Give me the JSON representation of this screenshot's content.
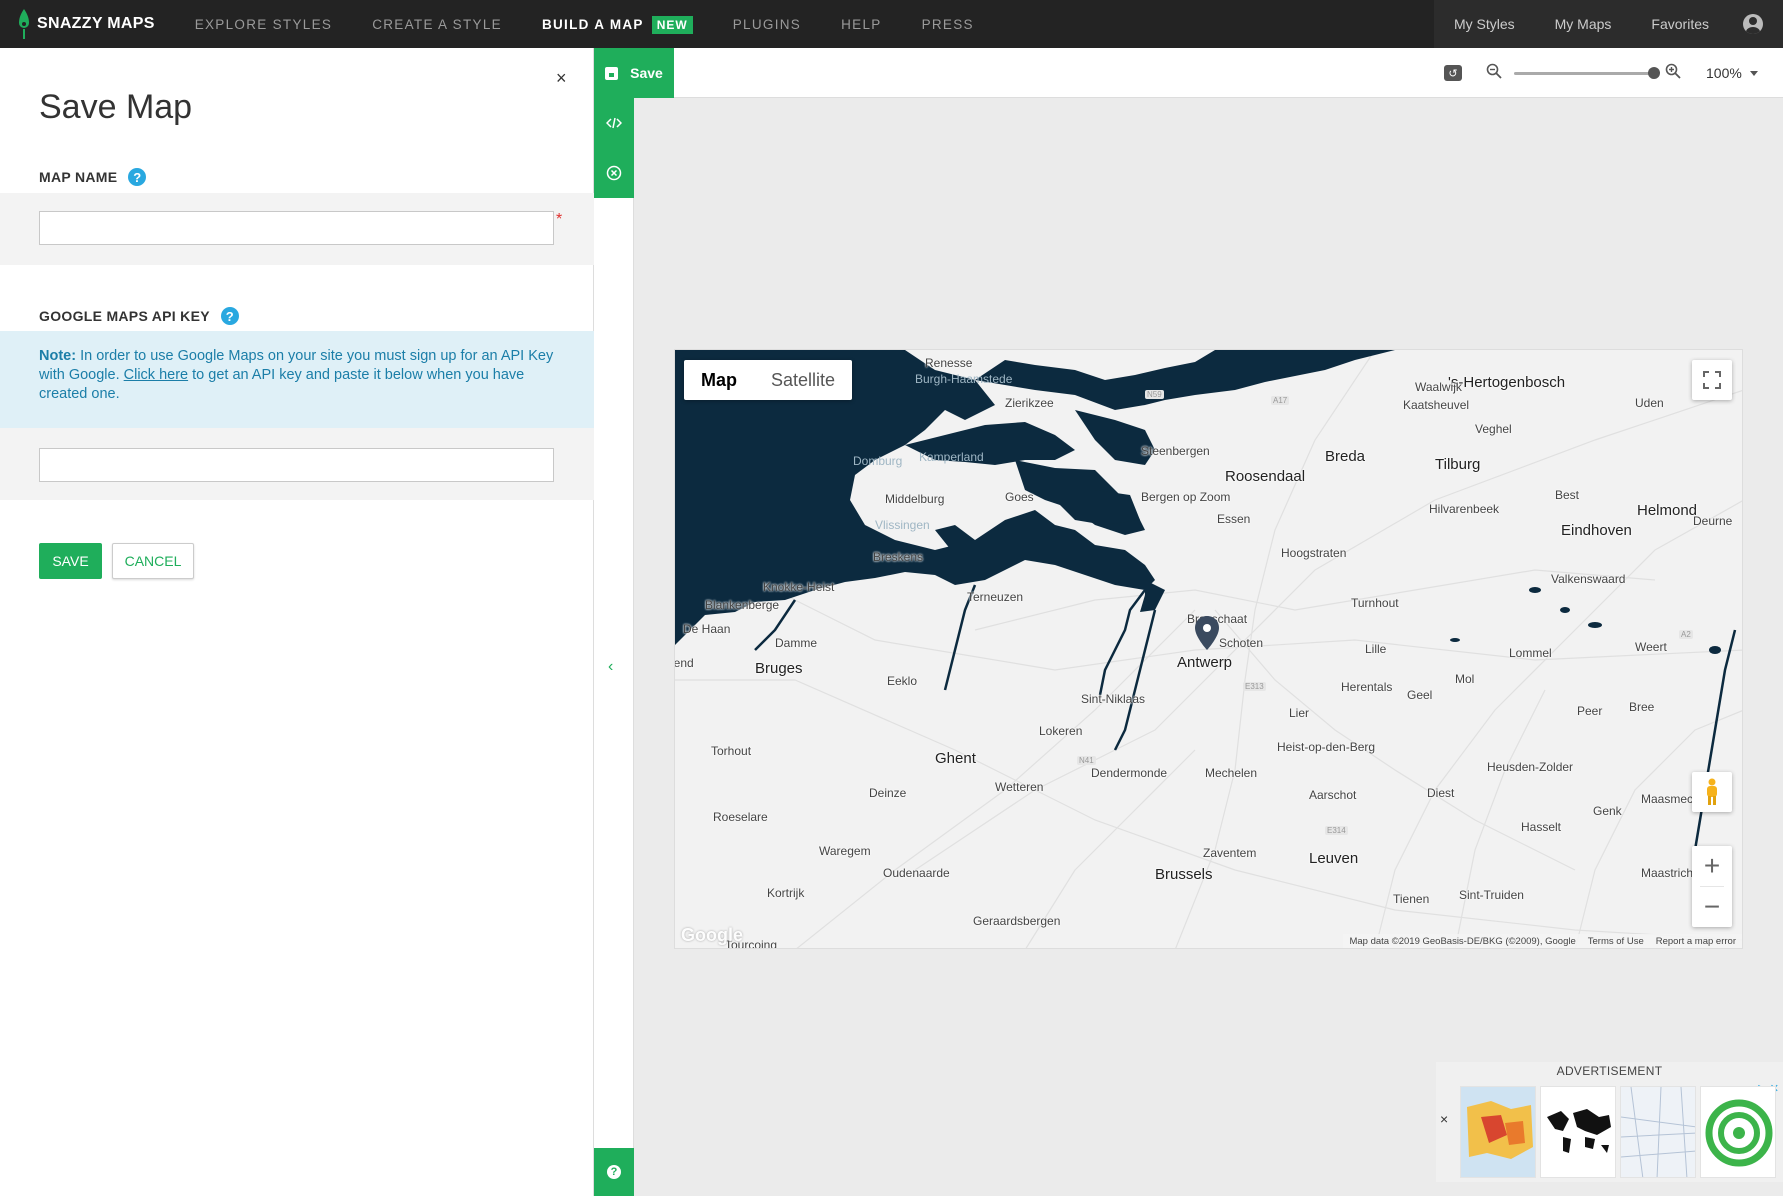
{
  "brand": {
    "name": "SNAZZY MAPS",
    "accent": "#1fae5b"
  },
  "nav": {
    "links": [
      {
        "label": "EXPLORE STYLES"
      },
      {
        "label": "CREATE A STYLE"
      },
      {
        "label": "BUILD A MAP",
        "badge": "NEW",
        "active": true
      },
      {
        "label": "PLUGINS"
      },
      {
        "label": "HELP"
      },
      {
        "label": "PRESS"
      }
    ],
    "right": [
      "My Styles",
      "My Maps",
      "Favorites"
    ],
    "account_icon": "user-circle-icon"
  },
  "panel": {
    "title": "Save Map",
    "close": "×",
    "map_name_label": "MAP NAME",
    "map_name_value": "",
    "required_marker": "*",
    "api_key_label": "GOOGLE MAPS API KEY",
    "api_key_value": "",
    "help_glyph": "?",
    "note": {
      "bold": "Note:",
      "text1": " In order to use Google Maps on your site you must sign up for an API Key with Google. ",
      "link": "Click here",
      "text2": " to get an API key and paste it below when you have created one."
    },
    "save_label": "SAVE",
    "cancel_label": "CANCEL"
  },
  "toolbar": {
    "save_label": "Save",
    "zoom_value": "100%",
    "zoom_fraction": 1.0,
    "icons": [
      "reset-icon",
      "zoom-out-icon",
      "zoom-in-icon"
    ]
  },
  "map": {
    "type_buttons": [
      {
        "label": "Map",
        "active": true
      },
      {
        "label": "Satellite",
        "active": false
      }
    ],
    "water_color": "#0c2a3f",
    "land_color": "#f2f2f2",
    "attribution": [
      "Map data ©2019 GeoBasis-DE/BKG (©2009), Google",
      "Terms of Use",
      "Report a map error"
    ],
    "google_logo": "Google",
    "zoom_in": "+",
    "zoom_out": "−",
    "places": [
      {
        "name": "Renesse"
      },
      {
        "name": "Burgh-Haamstede"
      },
      {
        "name": "Zierikzee"
      },
      {
        "name": "Domburg"
      },
      {
        "name": "Kamperland"
      },
      {
        "name": "Middelburg"
      },
      {
        "name": "Goes"
      },
      {
        "name": "Vlissingen"
      },
      {
        "name": "Breskens"
      },
      {
        "name": "Knokke-Heist"
      },
      {
        "name": "Blankenberge"
      },
      {
        "name": "De Haan"
      },
      {
        "name": "Damme"
      },
      {
        "name": "Bruges"
      },
      {
        "name": "Eeklo"
      },
      {
        "name": "Terneuzen"
      },
      {
        "name": "Steenbergen"
      },
      {
        "name": "Roosendaal"
      },
      {
        "name": "Bergen op Zoom"
      },
      {
        "name": "Essen"
      },
      {
        "name": "Breda"
      },
      {
        "name": "Tilburg"
      },
      {
        "name": "'s-Hertogenbosch"
      },
      {
        "name": "Waalwijk"
      },
      {
        "name": "Kaatsheuvel"
      },
      {
        "name": "Uden"
      },
      {
        "name": "Veghel"
      },
      {
        "name": "Best"
      },
      {
        "name": "Hilvarenbeek"
      },
      {
        "name": "Helmond"
      },
      {
        "name": "Eindhoven"
      },
      {
        "name": "Deurne"
      },
      {
        "name": "Hoogstraten"
      },
      {
        "name": "Valkenswaard"
      },
      {
        "name": "Turnhout"
      },
      {
        "name": "Brasschaat"
      },
      {
        "name": "Schoten"
      },
      {
        "name": "Antwerp"
      },
      {
        "name": "Lille"
      },
      {
        "name": "Lommel"
      },
      {
        "name": "Weert"
      },
      {
        "name": "Mol"
      },
      {
        "name": "Herentals"
      },
      {
        "name": "Geel"
      },
      {
        "name": "Sint-Niklaas"
      },
      {
        "name": "Lier"
      },
      {
        "name": "Peer"
      },
      {
        "name": "Bree"
      },
      {
        "name": "Lokeren"
      },
      {
        "name": "Heist-op-den-Berg"
      },
      {
        "name": "Torhout"
      },
      {
        "name": "Ghent"
      },
      {
        "name": "Dendermonde"
      },
      {
        "name": "Mechelen"
      },
      {
        "name": "Heusden-Zolder"
      },
      {
        "name": "Wetteren"
      },
      {
        "name": "Deinze"
      },
      {
        "name": "Aarschot"
      },
      {
        "name": "Diest"
      },
      {
        "name": "Maasmechelen"
      },
      {
        "name": "Genk"
      },
      {
        "name": "Roeselare"
      },
      {
        "name": "Hasselt"
      },
      {
        "name": "Waregem"
      },
      {
        "name": "Zaventem"
      },
      {
        "name": "Leuven"
      },
      {
        "name": "Oudenaarde"
      },
      {
        "name": "Brussels"
      },
      {
        "name": "Maastricht"
      },
      {
        "name": "Kortrijk"
      },
      {
        "name": "Sint-Truiden"
      },
      {
        "name": "Tienen"
      },
      {
        "name": "Geraardsbergen"
      },
      {
        "name": "Tourcoing"
      },
      {
        "name": "Ostend"
      }
    ]
  },
  "advertisement": {
    "label": "ADVERTISEMENT",
    "close": "×"
  }
}
